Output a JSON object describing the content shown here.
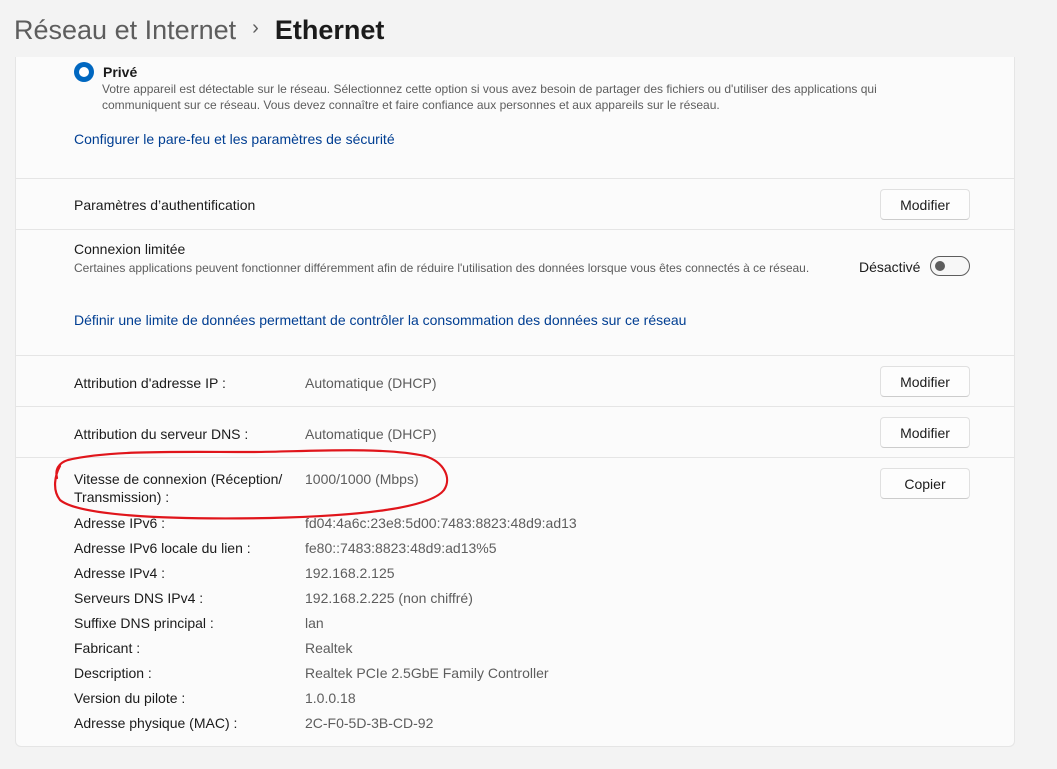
{
  "breadcrumb": {
    "parent": "Réseau et Internet",
    "separator": "›",
    "current": "Ethernet"
  },
  "network_profile": {
    "option_label": "Privé",
    "option_selected": true,
    "option_description": "Votre appareil est détectable sur le réseau. Sélectionnez cette option si vous avez besoin de partager des fichiers ou d'utiliser des applications qui communiquent sur ce réseau. Vous devez connaître et faire confiance aux personnes et aux appareils sur le réseau.",
    "firewall_link": "Configurer le pare-feu et les paramètres de sécurité"
  },
  "auth_settings": {
    "label": "Paramètres d’authentification",
    "button": "Modifier"
  },
  "metered": {
    "title": "Connexion limitée",
    "description": "Certaines applications peuvent fonctionner différemment afin de réduire l'utilisation des données lorsque vous êtes connectés à ce réseau.",
    "toggle_label": "Désactivé",
    "toggle_on": false,
    "data_limit_link": "Définir une limite de données permettant de contrôler la consommation des données sur ce réseau"
  },
  "ip_assignment": {
    "label": "Attribution d'adresse IP :",
    "value": "Automatique (DHCP)",
    "button": "Modifier"
  },
  "dns_assignment": {
    "label": "Attribution du serveur DNS :",
    "value": "Automatique (DHCP)",
    "button": "Modifier"
  },
  "properties": {
    "copy_button": "Copier",
    "items": [
      {
        "label": "Vitesse de connexion (Réception/ Transmission) :",
        "value": "1000/1000 (Mbps)"
      },
      {
        "label": "Adresse IPv6 :",
        "value": "fd04:4a6c:23e8:5d00:7483:8823:48d9:ad13"
      },
      {
        "label": "Adresse IPv6 locale du lien :",
        "value": "fe80::7483:8823:48d9:ad13%5"
      },
      {
        "label": "Adresse IPv4 :",
        "value": "192.168.2.125"
      },
      {
        "label": "Serveurs DNS IPv4 :",
        "value": "192.168.2.225 (non chiffré)"
      },
      {
        "label": "Suffixe DNS principal :",
        "value": "lan"
      },
      {
        "label": "Fabricant :",
        "value": "Realtek"
      },
      {
        "label": "Description :",
        "value": "Realtek PCIe 2.5GbE Family Controller"
      },
      {
        "label": "Version du pilote :",
        "value": "1.0.0.18"
      },
      {
        "label": "Adresse physique (MAC) :",
        "value": "2C-F0-5D-3B-CD-92"
      }
    ]
  },
  "colors": {
    "accent": "#0067c0",
    "link": "#003e92",
    "annotation": "#e0151b"
  }
}
